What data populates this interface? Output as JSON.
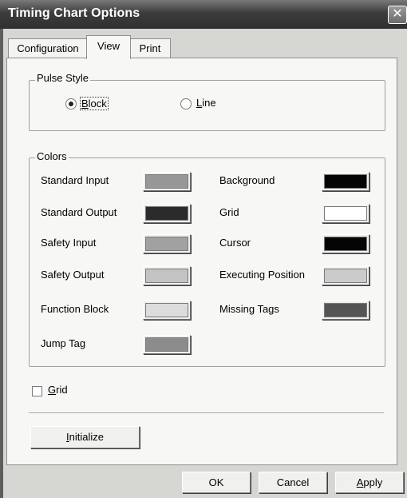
{
  "window": {
    "title": "Timing Chart Options",
    "close_glyph": "✕"
  },
  "tabs": [
    {
      "label": "Configuration"
    },
    {
      "label": "View",
      "selected": true
    },
    {
      "label": "Print"
    }
  ],
  "pulse_style": {
    "legend": "Pulse Style",
    "options": [
      {
        "label_underlined": "B",
        "label_rest": "lock",
        "selected": true
      },
      {
        "label_underlined": "L",
        "label_rest": "ine",
        "selected": false
      }
    ]
  },
  "colors": {
    "legend": "Colors",
    "left": [
      {
        "label": "Standard Input",
        "color": "#979797"
      },
      {
        "label": "Standard Output",
        "color": "#2b2b2b"
      },
      {
        "label": "Safety Input",
        "color": "#a1a1a1"
      },
      {
        "label": "Safety Output",
        "color": "#c3c3c3"
      },
      {
        "label": "Function Block",
        "color": "#dcdcdc"
      },
      {
        "label": "Jump Tag",
        "color": "#8c8c8c"
      }
    ],
    "right": [
      {
        "label": "Background",
        "color": "#050505"
      },
      {
        "label": "Grid",
        "color": "#ffffff"
      },
      {
        "label": "Cursor",
        "color": "#050505"
      },
      {
        "label": "Executing Position",
        "color": "#cbcbcb"
      },
      {
        "label": "Missing Tags",
        "color": "#555555"
      }
    ]
  },
  "grid_checkbox": {
    "label_underlined": "G",
    "label_rest": "rid",
    "checked": false
  },
  "buttons": {
    "initialize": {
      "label_underlined": "I",
      "label_rest": "nitialize"
    },
    "ok": {
      "label": "OK"
    },
    "cancel": {
      "label": "Cancel"
    },
    "apply": {
      "label_underlined": "A",
      "label_rest": "pply"
    }
  }
}
